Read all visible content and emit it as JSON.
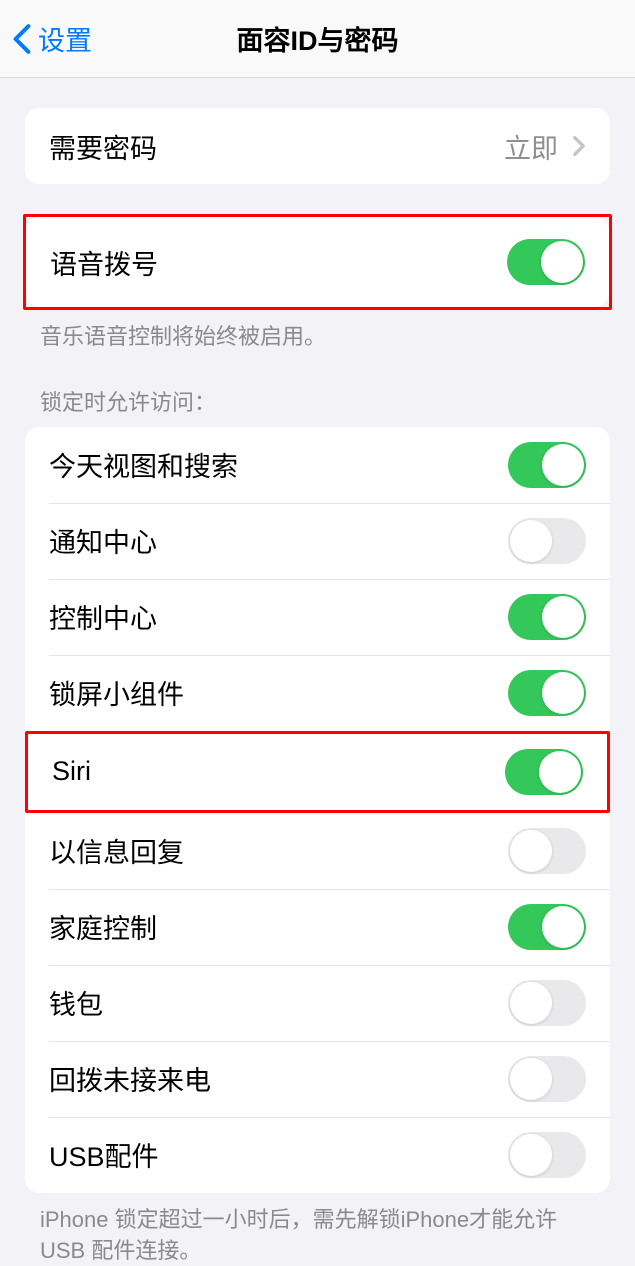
{
  "nav": {
    "back_label": "设置",
    "title": "面容ID与密码"
  },
  "require_passcode": {
    "label": "需要密码",
    "value": "立即"
  },
  "voice_dial": {
    "label": "语音拨号",
    "footer": "音乐语音控制将始终被启用。"
  },
  "allow_access": {
    "header": "锁定时允许访问：",
    "items": [
      {
        "label": "今天视图和搜索",
        "on": true
      },
      {
        "label": "通知中心",
        "on": false
      },
      {
        "label": "控制中心",
        "on": true
      },
      {
        "label": "锁屏小组件",
        "on": true
      },
      {
        "label": "Siri",
        "on": true
      },
      {
        "label": "以信息回复",
        "on": false
      },
      {
        "label": "家庭控制",
        "on": true
      },
      {
        "label": "钱包",
        "on": false
      },
      {
        "label": "回拨未接来电",
        "on": false
      },
      {
        "label": "USB配件",
        "on": false
      }
    ],
    "footer": "iPhone 锁定超过一小时后，需先解锁iPhone才能允许USB 配件连接。"
  }
}
